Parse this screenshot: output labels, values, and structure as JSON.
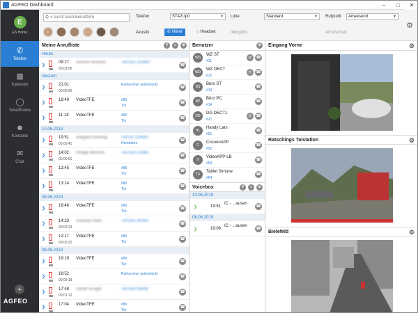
{
  "window": {
    "title": "AGFEO Dashboard"
  },
  "sidebar": {
    "home_label": "ES Home",
    "logo_letter": "E",
    "items": [
      {
        "label": "Telefon",
        "icon": "phone-icon",
        "active": true
      },
      {
        "label": "Kalender",
        "icon": "calendar-icon",
        "active": false
      },
      {
        "label": "Smarthome",
        "icon": "bulb-icon",
        "active": false
      },
      {
        "label": "Kontakte",
        "icon": "contacts-icon",
        "active": false
      },
      {
        "label": "Chat",
        "icon": "chat-icon",
        "active": false
      }
    ],
    "brand": "AGFEO"
  },
  "topbar": {
    "search_placeholder": "# sucht nach Benutzern",
    "telefon_label": "Telefon",
    "telefon_value": "ST42Up0",
    "linie_label": "Linie",
    "linie_value": "Standard",
    "rufprofil_label": "Rufprofil",
    "rufprofil_value": "Anwesend",
    "akustik_label": "Akustik",
    "hoerer_label": "Hörer",
    "headset_label": "Headset",
    "inkognito_label": "Inkognito",
    "anrufschutz_label": "Anrufschutz"
  },
  "calls": {
    "title": "Meine Anrufliste",
    "groups": [
      {
        "date": "Heute",
        "rows": [
          {
            "time": "09:27",
            "dur": "00:03:05",
            "name": "Simone Brauner",
            "blurred": true,
            "num": "+49 5241 1234567",
            "sub": ""
          }
        ]
      },
      {
        "date": "Gestern",
        "rows": [
          {
            "time": "21:01",
            "dur": "00:00:00",
            "name": "",
            "blurred": false,
            "num": "Rufnummer unterdrückt",
            "sub": ""
          },
          {
            "time": "18:49",
            "dur": "",
            "name": "VideoTFE",
            "blurred": false,
            "num": "#80",
            "sub": "Tür"
          },
          {
            "time": "11:18",
            "dur": "",
            "name": "VideoTFE",
            "blurred": false,
            "num": "#80",
            "sub": "Tür"
          }
        ]
      },
      {
        "date": "10.06.2019",
        "rows": [
          {
            "time": "19:51",
            "dur": "00:00:41",
            "name": "Ilsegard Kersting",
            "blurred": true,
            "num": "+49 521 1234567",
            "sub": "Homebüro"
          },
          {
            "time": "14:02",
            "dur": "00:00:51",
            "name": "Philipp Mertens",
            "blurred": true,
            "num": "+49 5241 123456",
            "sub": ""
          },
          {
            "time": "13:45",
            "dur": "",
            "name": "VideoTFE",
            "blurred": false,
            "num": "#80",
            "sub": "Tür"
          },
          {
            "time": "13:14",
            "dur": "",
            "name": "VideoTFE",
            "blurred": false,
            "num": "#80",
            "sub": "Tür"
          }
        ]
      },
      {
        "date": "09.06.2019",
        "rows": [
          {
            "time": "18:46",
            "dur": "",
            "name": "VideoTFE",
            "blurred": false,
            "num": "#80",
            "sub": "Tür"
          },
          {
            "time": "14:23",
            "dur": "00:02:24",
            "name": "Andreas Klein",
            "blurred": true,
            "num": "+49 5241 987654",
            "sub": ""
          },
          {
            "time": "12:17",
            "dur": "00:00:32",
            "name": "VideoTFE",
            "blurred": false,
            "num": "#80",
            "sub": "Tür"
          }
        ]
      },
      {
        "date": "08.06.2019",
        "rows": [
          {
            "time": "19:19",
            "dur": "",
            "name": "VideoTFE",
            "blurred": false,
            "num": "#80",
            "sub": "Tür"
          },
          {
            "time": "18:52",
            "dur": "00:03:18",
            "name": "",
            "blurred": false,
            "num": "Rufnummer unterdrückt",
            "sub": ""
          },
          {
            "time": "17:48",
            "dur": "00:01:12",
            "name": "Stefan Krüger",
            "blurred": true,
            "num": "+49 5241 555555",
            "sub": ""
          },
          {
            "time": "17:04",
            "dur": "",
            "name": "VideoTFE",
            "blurred": false,
            "num": "#80",
            "sub": "Tür"
          }
        ]
      }
    ]
  },
  "users": {
    "title": "Benutzer",
    "rows": [
      {
        "initials": "WS",
        "name": "WZ ST",
        "ext": "#11",
        "extra": true
      },
      {
        "initials": "WD",
        "name": "WZ DECT",
        "ext": "#12",
        "extra": true
      },
      {
        "initials": "BS",
        "name": "Büro ST",
        "ext": "#13",
        "extra": false
      },
      {
        "initials": "BP",
        "name": "Büro PC",
        "ext": "#14",
        "extra": false
      },
      {
        "initials": "DD",
        "name": "DG DECT1",
        "ext": "#21",
        "extra": true
      },
      {
        "initials": "HL",
        "name": "Handy Lars",
        "ext": "#51",
        "extra": false
      },
      {
        "initials": "C",
        "name": "CocoonAPP",
        "ext": "#52",
        "extra": false
      },
      {
        "initials": "V",
        "name": "VideoAPP-LB",
        "ext": "#53",
        "extra": false
      },
      {
        "initials": "TS",
        "name": "Tablet Simone",
        "ext": "#54",
        "extra": false
      }
    ]
  },
  "voicebox": {
    "title": "Voicebox",
    "groups": [
      {
        "date": "10.06.2019",
        "rows": [
          {
            "time": "19:51",
            "caller": "IC - ...ausen"
          }
        ]
      },
      {
        "date": "06.06.2019",
        "rows": [
          {
            "time": "19:06",
            "caller": "IC - ...ausen"
          }
        ]
      }
    ]
  },
  "cameras": [
    {
      "title": "Eingang Vorne"
    },
    {
      "title": "Ratschings Talstation"
    },
    {
      "title": "Bielefeld"
    }
  ]
}
